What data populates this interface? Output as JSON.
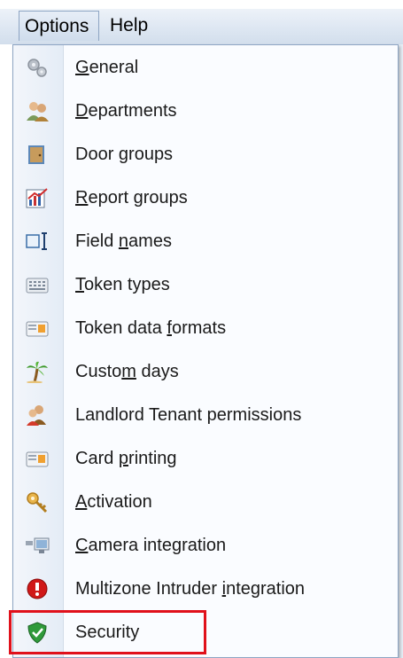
{
  "menubar": {
    "options_label": "Options",
    "help_label": "Help"
  },
  "menu": {
    "items": [
      {
        "label_pre": "",
        "label_key": "G",
        "label_post": "eneral",
        "icon": "gears-icon"
      },
      {
        "label_pre": "",
        "label_key": "D",
        "label_post": "epartments",
        "icon": "people-icon"
      },
      {
        "label_pre": "Door ",
        "label_key": "g",
        "label_post": "roups",
        "icon": "door-icon"
      },
      {
        "label_pre": "",
        "label_key": "R",
        "label_post": "eport groups",
        "icon": "report-chart-icon"
      },
      {
        "label_pre": "Field ",
        "label_key": "n",
        "label_post": "ames",
        "icon": "text-field-icon"
      },
      {
        "label_pre": "",
        "label_key": "T",
        "label_post": "oken types",
        "icon": "keypad-card-icon"
      },
      {
        "label_pre": "Token data ",
        "label_key": "f",
        "label_post": "ormats",
        "icon": "card-icon"
      },
      {
        "label_pre": "Custo",
        "label_key": "m",
        "label_post": " days",
        "icon": "palm-tree-icon"
      },
      {
        "label_pre": "Landlord Tenant permissions",
        "label_key": "",
        "label_post": "",
        "icon": "people-permissions-icon"
      },
      {
        "label_pre": "Card ",
        "label_key": "p",
        "label_post": "rinting",
        "icon": "card-icon"
      },
      {
        "label_pre": "",
        "label_key": "A",
        "label_post": "ctivation",
        "icon": "key-icon"
      },
      {
        "label_pre": "",
        "label_key": "C",
        "label_post": "amera integration",
        "icon": "camera-icon"
      },
      {
        "label_pre": "Multizone Intruder ",
        "label_key": "i",
        "label_post": "ntegration",
        "icon": "alarm-icon"
      },
      {
        "label_pre": "Security",
        "label_key": "",
        "label_post": "",
        "icon": "shield-icon"
      }
    ]
  },
  "colors": {
    "highlight": "#e0111b"
  }
}
